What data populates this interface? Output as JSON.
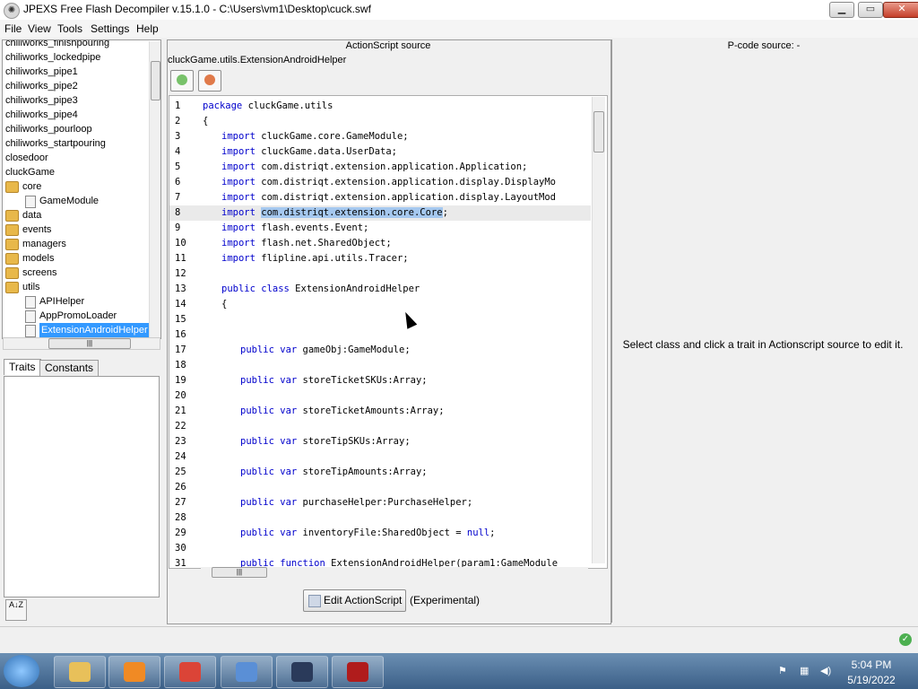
{
  "window": {
    "title": "JPEXS Free Flash Decompiler v.15.1.0 - C:\\Users\\vm1\\Desktop\\cuck.swf",
    "app_icon": "ffdec-icon",
    "minimize": "▁",
    "maximize": "▭",
    "close": "✕"
  },
  "menu": [
    "File",
    "View",
    "Tools",
    "Settings",
    "Help"
  ],
  "tree": {
    "items": [
      {
        "label": "chiliworks_finishpouring",
        "type": "text",
        "indent": 0
      },
      {
        "label": "chiliworks_lockedpipe",
        "type": "text",
        "indent": 0
      },
      {
        "label": "chiliworks_pipe1",
        "type": "text",
        "indent": 0
      },
      {
        "label": "chiliworks_pipe2",
        "type": "text",
        "indent": 0
      },
      {
        "label": "chiliworks_pipe3",
        "type": "text",
        "indent": 0
      },
      {
        "label": "chiliworks_pipe4",
        "type": "text",
        "indent": 0
      },
      {
        "label": "chiliworks_pourloop",
        "type": "text",
        "indent": 0
      },
      {
        "label": "chiliworks_startpouring",
        "type": "text",
        "indent": 0
      },
      {
        "label": "closedoor",
        "type": "text",
        "indent": 0
      },
      {
        "label": "cluckGame",
        "type": "text",
        "indent": 0
      },
      {
        "label": "core",
        "type": "package",
        "indent": 1
      },
      {
        "label": "GameModule",
        "type": "class",
        "indent": 2
      },
      {
        "label": "data",
        "type": "package",
        "indent": 1
      },
      {
        "label": "events",
        "type": "package",
        "indent": 1
      },
      {
        "label": "managers",
        "type": "package",
        "indent": 1
      },
      {
        "label": "models",
        "type": "package",
        "indent": 1
      },
      {
        "label": "screens",
        "type": "package",
        "indent": 1
      },
      {
        "label": "utils",
        "type": "package",
        "indent": 1
      },
      {
        "label": "APIHelper",
        "type": "class",
        "indent": 2
      },
      {
        "label": "AppPromoLoader",
        "type": "class",
        "indent": 2
      },
      {
        "label": "ExtensionAndroidHelper",
        "type": "class",
        "indent": 2,
        "selected": true
      }
    ],
    "hscroll_grip": "|||"
  },
  "traits": {
    "tabs": [
      "Traits",
      "Constants"
    ],
    "sort_button": "A↓Z"
  },
  "actionscript": {
    "header": "ActionScript source",
    "path": "cluckGame.utils.ExtensionAndroidHelper",
    "hscroll_grip": "|||",
    "selected_line": 8,
    "lines": [
      {
        "n": "1",
        "indent": 0,
        "kw": "package",
        "rest": " cluckGame.utils"
      },
      {
        "n": "2",
        "indent": 0,
        "kw": "",
        "rest": "{"
      },
      {
        "n": "3",
        "indent": 1,
        "kw": "import",
        "rest": " cluckGame.core.GameModule;"
      },
      {
        "n": "4",
        "indent": 1,
        "kw": "import",
        "rest": " cluckGame.data.UserData;"
      },
      {
        "n": "5",
        "indent": 1,
        "kw": "import",
        "rest": " com.distriqt.extension.application.Application;"
      },
      {
        "n": "6",
        "indent": 1,
        "kw": "import",
        "rest": " com.distriqt.extension.application.display.DisplayMo"
      },
      {
        "n": "7",
        "indent": 1,
        "kw": "import",
        "rest": " com.distriqt.extension.application.display.LayoutMod"
      },
      {
        "n": "8",
        "indent": 1,
        "kw": "import",
        "rest": " ",
        "sel": "com.distriqt.extension.core.Core",
        "after": ";"
      },
      {
        "n": "9",
        "indent": 1,
        "kw": "import",
        "rest": " flash.events.Event;"
      },
      {
        "n": "10",
        "indent": 1,
        "kw": "import",
        "rest": " flash.net.SharedObject;"
      },
      {
        "n": "11",
        "indent": 1,
        "kw": "import",
        "rest": " flipline.api.utils.Tracer;"
      },
      {
        "n": "12",
        "indent": 0,
        "kw": "",
        "rest": ""
      },
      {
        "n": "13",
        "indent": 1,
        "kw": "public class",
        "rest": " ExtensionAndroidHelper"
      },
      {
        "n": "14",
        "indent": 1,
        "kw": "",
        "rest": "{"
      },
      {
        "n": "15",
        "indent": 0,
        "kw": "",
        "rest": ""
      },
      {
        "n": "16",
        "indent": 0,
        "kw": "",
        "rest": ""
      },
      {
        "n": "17",
        "indent": 2,
        "kw": "public var",
        "rest": " gameObj:GameModule;"
      },
      {
        "n": "18",
        "indent": 0,
        "kw": "",
        "rest": ""
      },
      {
        "n": "19",
        "indent": 2,
        "kw": "public var",
        "rest": " storeTicketSKUs:Array;"
      },
      {
        "n": "20",
        "indent": 0,
        "kw": "",
        "rest": ""
      },
      {
        "n": "21",
        "indent": 2,
        "kw": "public var",
        "rest": " storeTicketAmounts:Array;"
      },
      {
        "n": "22",
        "indent": 0,
        "kw": "",
        "rest": ""
      },
      {
        "n": "23",
        "indent": 2,
        "kw": "public var",
        "rest": " storeTipSKUs:Array;"
      },
      {
        "n": "24",
        "indent": 0,
        "kw": "",
        "rest": ""
      },
      {
        "n": "25",
        "indent": 2,
        "kw": "public var",
        "rest": " storeTipAmounts:Array;"
      },
      {
        "n": "26",
        "indent": 0,
        "kw": "",
        "rest": ""
      },
      {
        "n": "27",
        "indent": 2,
        "kw": "public var",
        "rest": " purchaseHelper:PurchaseHelper;"
      },
      {
        "n": "28",
        "indent": 0,
        "kw": "",
        "rest": ""
      },
      {
        "n": "29",
        "indent": 2,
        "kw": "public var",
        "rest": " inventoryFile:SharedObject = ",
        "lit": "null",
        "after": ";"
      },
      {
        "n": "30",
        "indent": 0,
        "kw": "",
        "rest": ""
      },
      {
        "n": "31",
        "indent": 2,
        "kw": "public function",
        "rest": " ExtensionAndroidHelper(param1:GameModule"
      }
    ],
    "edit_button": "Edit ActionScript",
    "experimental": "(Experimental)"
  },
  "pcode": {
    "title": "P-code source: -",
    "message": "Select class and click a trait in Actionscript source to edit it."
  },
  "status": {
    "ok_icon": "✓"
  },
  "taskbar": {
    "tasks": [
      {
        "name": "explorer-task",
        "color": "#e8c05a"
      },
      {
        "name": "media-player-task",
        "color": "#f08a24"
      },
      {
        "name": "chrome-task",
        "color": "#db4437"
      },
      {
        "name": "installer-task",
        "color": "#5a8fd6"
      },
      {
        "name": "ffdec-task",
        "color": "#2a3a5a"
      },
      {
        "name": "flash-task",
        "color": "#b01c1c"
      }
    ],
    "time": "5:04 PM",
    "date": "5/19/2022"
  }
}
